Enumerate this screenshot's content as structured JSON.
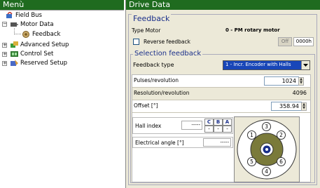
{
  "left_panel": {
    "title": "Menù",
    "items": [
      {
        "label": "Field Bus",
        "icon": "fieldbus-icon",
        "expander": ""
      },
      {
        "label": "Motor Data",
        "icon": "motor-icon",
        "expander": "−"
      },
      {
        "label": "Feedback",
        "icon": "feedback-icon",
        "expander": ""
      },
      {
        "label": "Advanced Setup",
        "icon": "advanced-setup-icon",
        "expander": "+"
      },
      {
        "label": "Control Set",
        "icon": "control-set-icon",
        "expander": "+"
      },
      {
        "label": "Reserved Setup",
        "icon": "reserved-setup-icon",
        "expander": "+"
      }
    ]
  },
  "right_panel": {
    "title": "Drive Data",
    "feedback_section": "Feedback",
    "type_motor_label": "Type Motor",
    "type_motor_value": "0 - PM rotary motor",
    "reverse_feedback_label": "Reverse feedback",
    "reverse_state": "Off",
    "reverse_code": "0000h",
    "selection_section": "Selection feedback",
    "feedback_type_label": "Feedback type",
    "feedback_type_value": "1 - Incr. Encoder with Halls",
    "pulses_label": "Pulses/revolution",
    "pulses_value": "1024",
    "resolution_label": "Resolution/revolution",
    "resolution_value": "4096",
    "offset_label": "Offset [°]",
    "offset_value": "358.94",
    "hall_index_label": "Hall index",
    "hall_index_value": "-----",
    "hall_headers": [
      "C",
      "B",
      "A"
    ],
    "hall_values": [
      "-",
      "-",
      "-"
    ],
    "electrical_angle_label": "Electrical angle [°]",
    "electrical_angle_value": "-----",
    "hall_positions": [
      "1",
      "2",
      "3",
      "4",
      "5",
      "6"
    ]
  },
  "colors": {
    "left_header": "#1f6b1f",
    "right_header": "#1f6b1f",
    "section_text": "#1a2f8a",
    "dropdown_bg": "#1846b8",
    "motor_olive": "#7a7a3a",
    "motor_bg": "#ece9d8"
  }
}
